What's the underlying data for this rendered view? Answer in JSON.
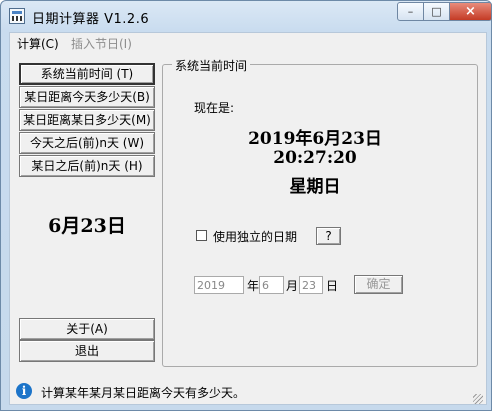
{
  "window": {
    "title": "日期计算器 V1.2.6",
    "min_icon": "minimize-icon",
    "max_icon": "maximize-icon",
    "close_icon": "close-icon"
  },
  "menu": {
    "calc": "计算(C)",
    "insert_holiday": "插入节日(I)"
  },
  "sidebar": {
    "buttons": [
      {
        "label": "系统当前时间  (T)",
        "active": true
      },
      {
        "label": "某日距离今天多少天(B)",
        "active": false
      },
      {
        "label": "某日距离某日多少天(M)",
        "active": false
      },
      {
        "label": "今天之后(前)n天  (W)",
        "active": false
      },
      {
        "label": "某日之后(前)n天  (H)",
        "active": false
      }
    ],
    "current_date": "6月23日",
    "about": "关于(A)",
    "exit": "退出"
  },
  "panel": {
    "group_title": "系统当前时间",
    "now_label": "现在是:",
    "date": "2019年6月23日",
    "time": "20:27:20",
    "weekday": "星期日",
    "independent_date_label": "使用独立的日期",
    "help_label": "?",
    "year_value": "2019",
    "year_unit": "年",
    "month_value": "6",
    "month_unit": "月",
    "day_value": "23",
    "day_unit": "日",
    "confirm_label": "确定"
  },
  "status": {
    "text": "计算某年某月某日距离今天有多少天。",
    "icon": "info-icon"
  }
}
